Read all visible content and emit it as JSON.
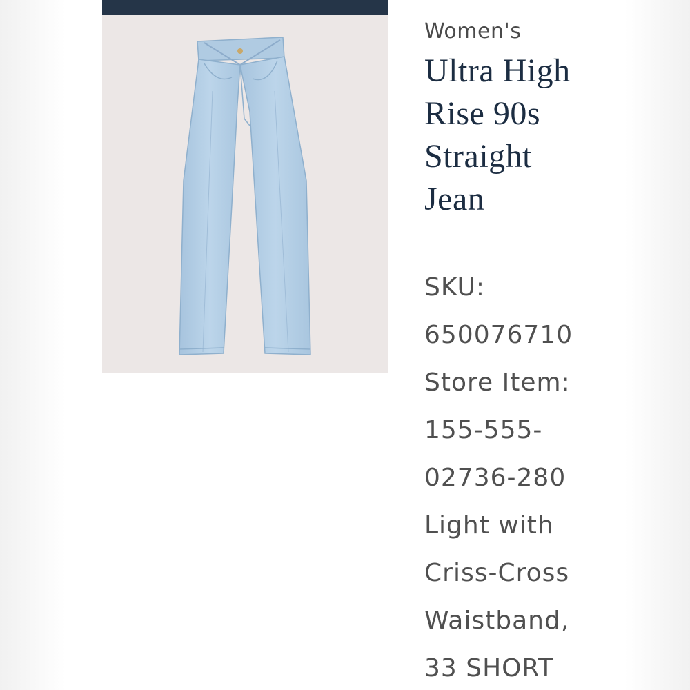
{
  "product": {
    "category": "Women's",
    "title_lines": [
      "Ultra High",
      "Rise 90s",
      "Straight",
      "Jean"
    ],
    "detail_lines": [
      "SKU:",
      "650076710",
      "Store Item:",
      "155-555-",
      "02736-280",
      "Light with",
      "Criss-Cross",
      "Waistband,",
      "33 SHORT"
    ],
    "image": {
      "icon": "jeans-image",
      "background_color": "#ece7e6",
      "denim_color": "#b3cde3"
    }
  },
  "colors": {
    "header_bar": "#253548",
    "title": "#1c2d42",
    "text": "#505050"
  }
}
